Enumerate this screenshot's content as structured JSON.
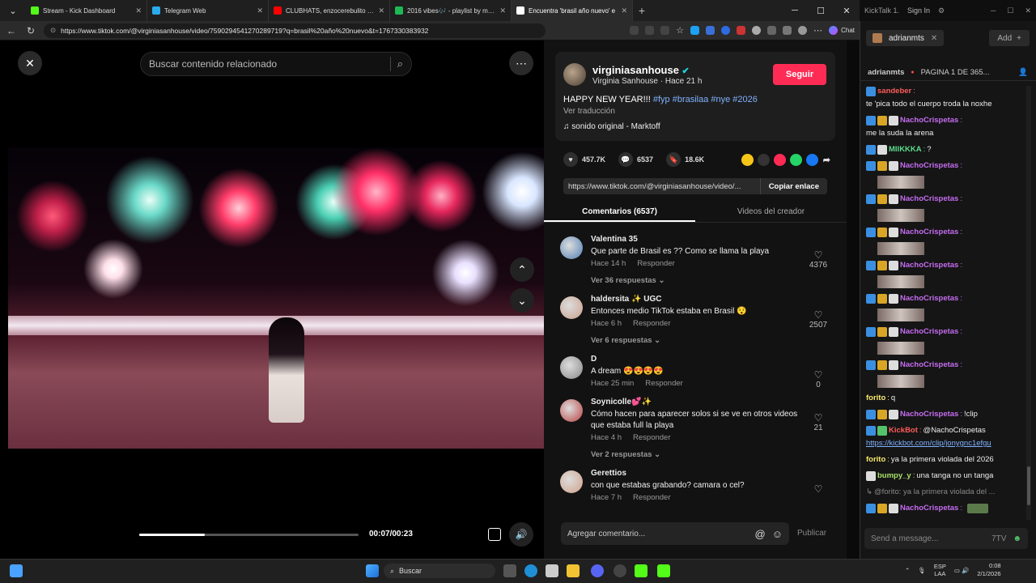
{
  "browser": {
    "tabs": [
      {
        "title": "Stream - Kick Dashboard",
        "color": "#53fc18",
        "active": false
      },
      {
        "title": "Telegram Web",
        "color": "#2aabee",
        "active": false
      },
      {
        "title": "CLUBHATS, enzocerebulito & CLÚS",
        "color": "#ff0000",
        "active": false
      },
      {
        "title": "2016 vibes🎶 - playlist by m | Spo",
        "color": "#1db954",
        "active": false
      },
      {
        "title": "Encuentra 'brasil año nuevo' e",
        "color": "#ffffff",
        "active": true
      }
    ],
    "url": "https://www.tiktok.com/@virginiasanhouse/video/7590294541270289719?q=brasil%20año%20nuevo&t=1767330383932",
    "chat_label": "Chat"
  },
  "video": {
    "search_placeholder": "Buscar contenido relacionado",
    "time": "00:07/00:23",
    "progress_fraction": 0.3
  },
  "author": {
    "username": "virginiasanhouse",
    "display": "Virginia Sanhouse · Hace 21 h",
    "follow_label": "Seguir",
    "caption_text": "HAPPY NEW YEAR!!! ",
    "hashtags": "#fyp #brasilaa #nye #2026",
    "translate": "Ver traducción",
    "sound": "sonido original - Marktoff"
  },
  "stats": {
    "likes": "457.7K",
    "comments": "6537",
    "saves": "18.6K"
  },
  "link": {
    "url": "https://www.tiktok.com/@virginiasanhouse/video/...",
    "copy_label": "Copiar enlace"
  },
  "tabs": {
    "comments": "Comentarios (6537)",
    "creator": "Videos del creador"
  },
  "comments": [
    {
      "name": "Valentina 35",
      "text": "Que parte de Brasil es ?? Como se llama la playa",
      "time": "Hace 14 h",
      "reply": "Responder",
      "likes": "4376",
      "replies": "Ver 36 respuestas ⌄",
      "avatar": "#4f7fb3"
    },
    {
      "name": "haldersita ✨ UGC",
      "text": "Entonces medio TikTok estaba en Brasil 😯",
      "time": "Hace 6 h",
      "reply": "Responder",
      "likes": "2507",
      "replies": "Ver 6 respuestas ⌄",
      "avatar": "#c9a08a"
    },
    {
      "name": "D",
      "text": "A dream 😍😍😍😍",
      "time": "Hace 25 min",
      "reply": "Responder",
      "likes": "0",
      "replies": "",
      "avatar": "#888888"
    },
    {
      "name": "Soynicolle💕✨",
      "text": "Cómo hacen para aparecer solos si se ve en otros videos que estaba full la playa",
      "time": "Hace 4 h",
      "reply": "Responder",
      "likes": "21",
      "replies": "Ver 2 respuestas ⌄",
      "avatar": "#b9403f"
    },
    {
      "name": "Gerettios",
      "text": "con que estabas grabando? camara o cel?",
      "time": "Hace 7 h",
      "reply": "Responder",
      "likes": "",
      "replies": "",
      "avatar": "#d0a088"
    }
  ],
  "add_comment": {
    "placeholder": "Agregar comentario...",
    "publish": "Publicar"
  },
  "kicktalk": {
    "app": "KickTalk 1.",
    "signin": "Sign In",
    "channel_tab": "adrianmts",
    "add_label": "Add",
    "channel": "adrianmts",
    "page": "PAGINA 1 DE 365...",
    "messages": [
      {
        "user": "sandeber",
        "color": "#ff5b5b",
        "text": "te 'pica todo el cuerpo troda la noxhe",
        "badges": [
          "b1"
        ]
      },
      {
        "user": "NachoCrispetas",
        "color": "#c56cf0",
        "text": "me la suda la arena",
        "badges": [
          "b1",
          "b2",
          "b3"
        ]
      },
      {
        "user": "MIIKKKA",
        "color": "#5ddc8b",
        "text": "?",
        "badges": [
          "b1",
          "b3"
        ]
      },
      {
        "user": "NachoCrispetas",
        "color": "#c56cf0",
        "text": "",
        "emote": true,
        "badges": [
          "b1",
          "b2",
          "b3"
        ]
      },
      {
        "user": "NachoCrispetas",
        "color": "#c56cf0",
        "text": "",
        "emote": true,
        "badges": [
          "b1",
          "b2",
          "b3"
        ]
      },
      {
        "user": "NachoCrispetas",
        "color": "#c56cf0",
        "text": "",
        "emote": true,
        "badges": [
          "b1",
          "b2",
          "b3"
        ]
      },
      {
        "user": "NachoCrispetas",
        "color": "#c56cf0",
        "text": "",
        "emote": true,
        "badges": [
          "b1",
          "b2",
          "b3"
        ]
      },
      {
        "user": "NachoCrispetas",
        "color": "#c56cf0",
        "text": "",
        "emote": true,
        "badges": [
          "b1",
          "b2",
          "b3"
        ]
      },
      {
        "user": "NachoCrispetas",
        "color": "#c56cf0",
        "text": "",
        "emote": true,
        "badges": [
          "b1",
          "b2",
          "b3"
        ]
      },
      {
        "user": "NachoCrispetas",
        "color": "#c56cf0",
        "text": "",
        "emote": true,
        "badges": [
          "b1",
          "b2",
          "b3"
        ]
      },
      {
        "user": "forito",
        "color": "#f7e96b",
        "text": "q",
        "badges": []
      },
      {
        "user": "NachoCrispetas",
        "color": "#c56cf0",
        "text": "!clip",
        "badges": [
          "b1",
          "b2",
          "b3"
        ]
      },
      {
        "user": "KickBot",
        "color": "#ff5b5b",
        "text": "@NachoCrispetas",
        "link": "https://kickbot.com/clip/jonygnc1efgu",
        "badges": [
          "b1",
          "b4"
        ]
      },
      {
        "user": "forito",
        "color": "#f7e96b",
        "text": "ya la primera violada del 2026",
        "badges": []
      },
      {
        "user": "bumpy_y",
        "color": "#a8e06b",
        "text": "una tanga no un tanga",
        "badges": [
          "b3"
        ]
      }
    ],
    "reply_preview": "@forito: ya la primera violada del ...",
    "last_user": "NachoCrispetas",
    "input_placeholder": "Send a message..."
  },
  "taskbar": {
    "search": "Buscar",
    "lang1": "ESP",
    "lang2": "LAA",
    "time": "0:08",
    "date": "2/1/2026"
  }
}
